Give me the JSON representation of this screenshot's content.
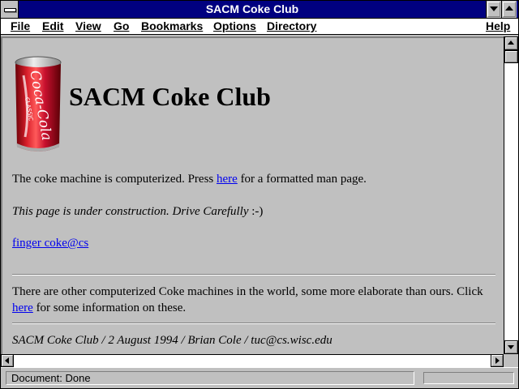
{
  "window": {
    "title": "SACM Coke Club"
  },
  "menu": {
    "items": [
      "File",
      "Edit",
      "View",
      "Go",
      "Bookmarks",
      "Options",
      "Directory"
    ],
    "help": "Help"
  },
  "page": {
    "heading": "SACM Coke Club",
    "para1_before": "The coke machine is computerized. Press ",
    "para1_link": "here",
    "para1_after": " for a formatted man page.",
    "construction_italic": "This page is under construction. Drive Carefully",
    "construction_smiley": " :-)",
    "finger_link": "finger coke@cs",
    "other_line1": "There are other computerized Coke machines in the world, some more elaborate than ours. Click",
    "other_link": "here",
    "other_after": " for some information on these.",
    "footer": "SACM Coke Club / 2 August 1994 / Brian Cole / tuc@cs.wisc.edu"
  },
  "can_image": {
    "icon": "coke-can-image",
    "brand_text": "Coca-Cola",
    "sub_text": "CLASSIC",
    "color": "#c8102e"
  },
  "status": {
    "text": "Document: Done",
    "progress_fraction": 0
  },
  "colors": {
    "titlebar": "#000080",
    "link": "#0000ee",
    "background": "#c0c0c0"
  }
}
